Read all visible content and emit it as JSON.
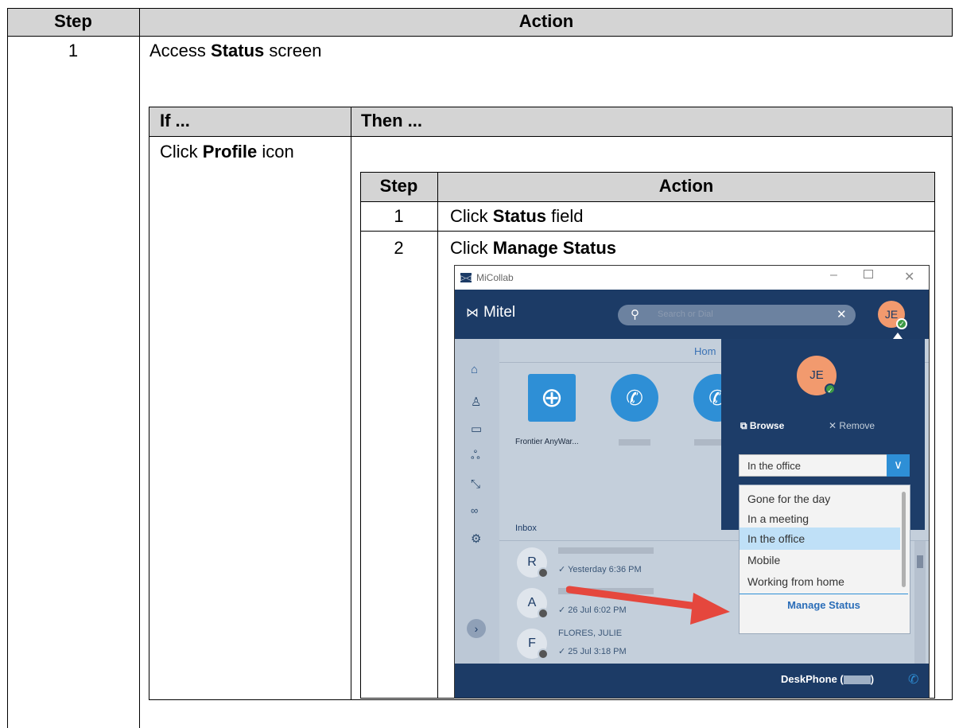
{
  "outer": {
    "header_step": "Step",
    "header_action": "Action",
    "row1_step": "1",
    "row1_text_pre": "Access ",
    "row1_text_bold": "Status",
    "row1_text_post": " screen"
  },
  "ifthen": {
    "header_if": "If ...",
    "header_then": "Then ...",
    "if_pre": "Click ",
    "if_bold": "Profile",
    "if_post": " icon"
  },
  "inner": {
    "header_step": "Step",
    "header_action": "Action",
    "step1": "1",
    "step1_pre": "Click ",
    "step1_bold": "Status",
    "step1_post": " field",
    "step2": "2",
    "step2_pre": "Click ",
    "step2_bold": "Manage Status"
  },
  "screenshot": {
    "window_title": "MiCollab",
    "brand": "Mitel",
    "search_placeholder": "Search or Dial",
    "avatar_initials": "JE",
    "home_tab": "Hom",
    "tiles": [
      "Frontier AnyWar..."
    ],
    "inbox_label": "Inbox",
    "browse_label": "Browse",
    "remove_label": "Remove",
    "status_selected": "In the office",
    "status_options": [
      "Gone for the day",
      "In a meeting",
      "In the office",
      "Mobile",
      "Working from home"
    ],
    "manage_status": "Manage Status",
    "inbox_items": [
      {
        "initial": "R",
        "time": "Yesterday 6:36 PM"
      },
      {
        "initial": "A",
        "time": "26 Jul 6:02 PM"
      },
      {
        "initial": "F",
        "time": "25 Jul 3:18 PM",
        "name": "FLORES, JULIE"
      }
    ],
    "deskphone_pre": "DeskPhone (",
    "deskphone_post": ")",
    "accent": "#1c3b66",
    "avatar_color": "#f29a6e",
    "arrow_color": "#e5473d",
    "highlight_color": "#bfe0f7"
  }
}
